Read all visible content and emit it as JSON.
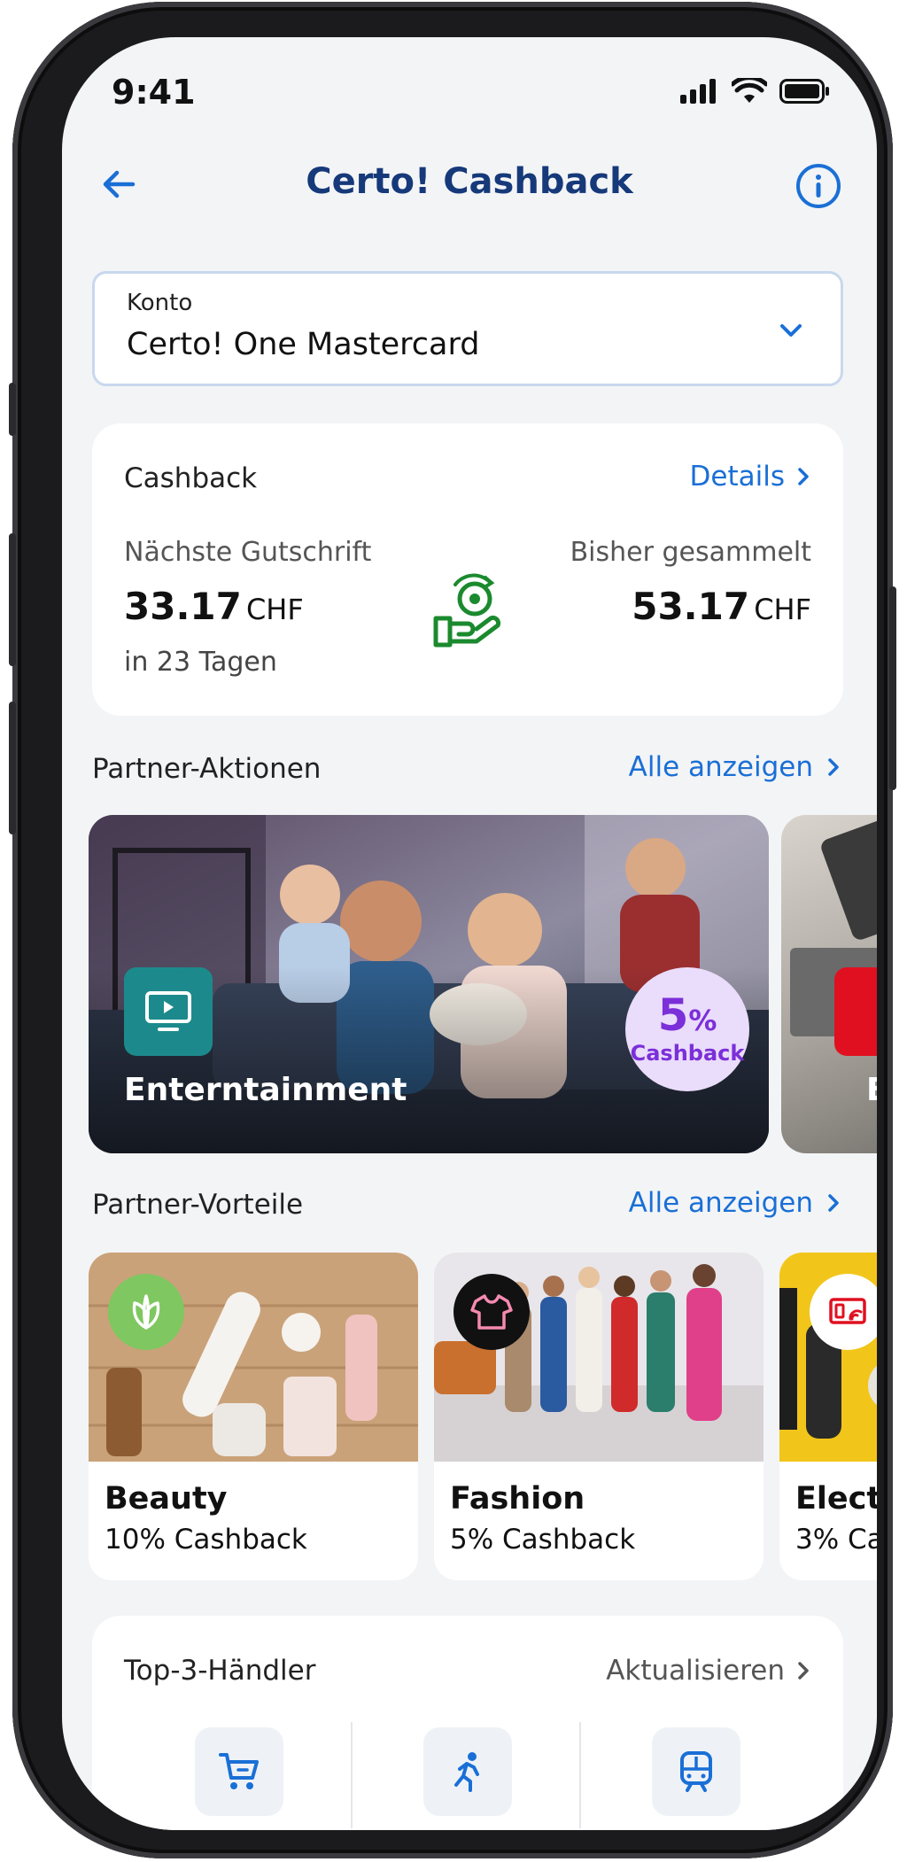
{
  "status": {
    "time": "9:41"
  },
  "header": {
    "title": "Certo! Cashback"
  },
  "account": {
    "label": "Konto",
    "value": "Certo! One Mastercard"
  },
  "cashback": {
    "title": "Cashback",
    "details_link": "Details",
    "next": {
      "label": "Nächste Gutschrift",
      "amount": "33.17",
      "currency": "CHF",
      "when": "in 23 Tagen"
    },
    "total": {
      "label": "Bisher gesammelt",
      "amount": "53.17",
      "currency": "CHF"
    }
  },
  "actions": {
    "title": "Partner-Aktionen",
    "show_all": "Alle anzeigen",
    "items": [
      {
        "label": "Enterntainment",
        "percent": "5",
        "percent_sign": "%",
        "badge_text": "Cashback"
      },
      {
        "label": "Ele"
      }
    ]
  },
  "benefits": {
    "title": "Partner-Vorteile",
    "show_all": "Alle anzeigen",
    "items": [
      {
        "name": "Beauty",
        "cashback": "10% Cashback",
        "icon": "leaf-icon"
      },
      {
        "name": "Fashion",
        "cashback": "5% Cashback",
        "icon": "tshirt-icon"
      },
      {
        "name": "Elect",
        "cashback": "3% Ca",
        "icon": "device-icon"
      }
    ]
  },
  "top3": {
    "title": "Top-3-Händler",
    "refresh": "Aktualisieren",
    "icons": [
      "cart-icon",
      "running-person-icon",
      "train-icon"
    ]
  },
  "colors": {
    "brand_blue": "#1a6fd6",
    "title_navy": "#16397a",
    "cashback_green": "#1b8a2e",
    "purple": "#7b2fd8"
  }
}
